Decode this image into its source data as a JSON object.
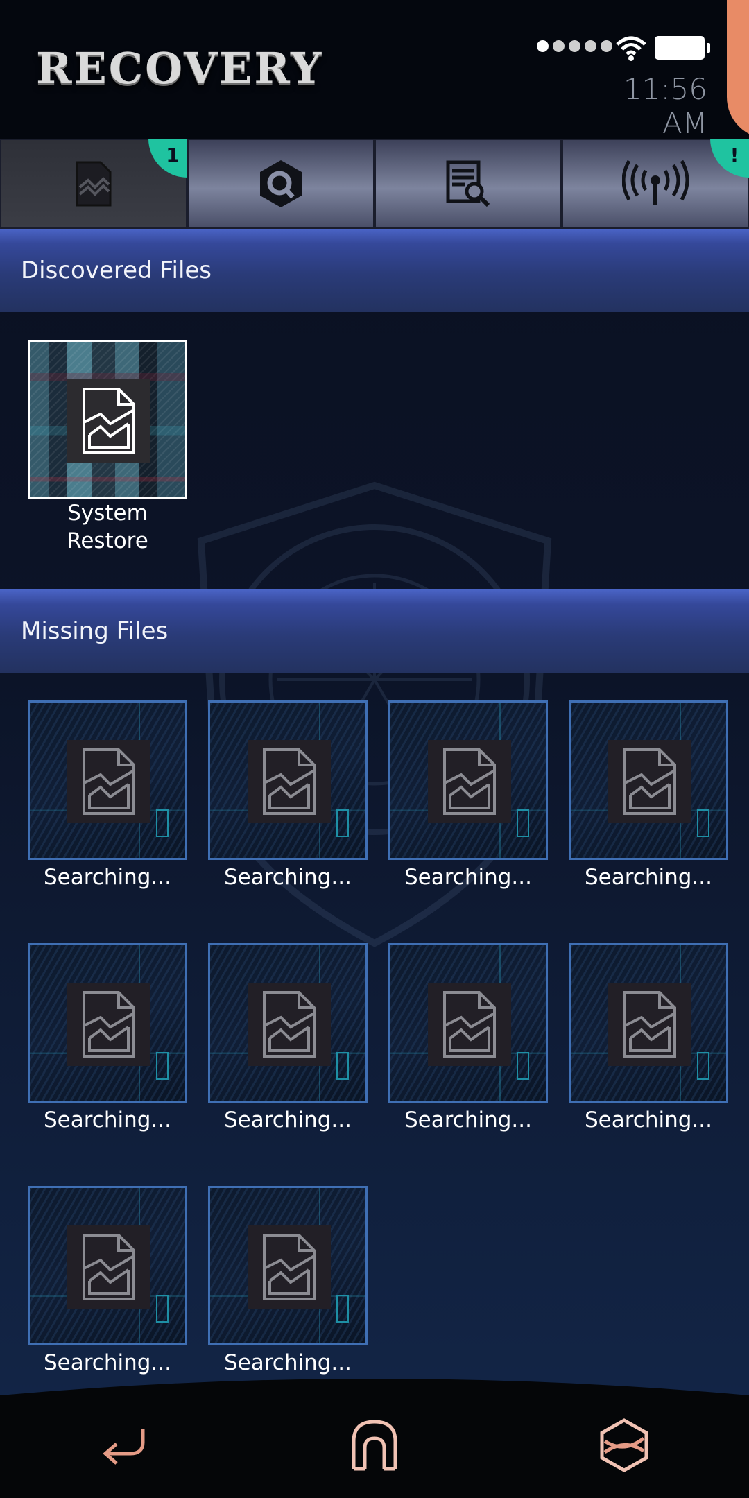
{
  "app": {
    "title": "RECOVERY",
    "clock": "11:56 AM"
  },
  "tabs": [
    {
      "name": "recovered-files",
      "icon": "corrupted-file-icon",
      "badge": "1",
      "active": true
    },
    {
      "name": "scan",
      "icon": "hexagon-search-icon",
      "badge": null,
      "active": false
    },
    {
      "name": "document-search",
      "icon": "document-magnifier-icon",
      "badge": null,
      "active": false
    },
    {
      "name": "broadcast",
      "icon": "broadcast-antenna-icon",
      "badge": "!",
      "active": false
    }
  ],
  "discovered": {
    "header": "Discovered Files",
    "files": [
      {
        "label_line1": "System",
        "label_line2": "Restore"
      }
    ]
  },
  "missing": {
    "header": "Missing Files",
    "files": [
      {
        "label": "Searching..."
      },
      {
        "label": "Searching..."
      },
      {
        "label": "Searching..."
      },
      {
        "label": "Searching..."
      },
      {
        "label": "Searching..."
      },
      {
        "label": "Searching..."
      },
      {
        "label": "Searching..."
      },
      {
        "label": "Searching..."
      },
      {
        "label": "Searching..."
      },
      {
        "label": "Searching..."
      }
    ]
  },
  "nav": {
    "back_icon": "back-arrow-icon",
    "home_icon": "home-icon",
    "apps_icon": "hexagon-apps-icon"
  },
  "colors": {
    "accent_badge": "#1fc3a0",
    "tile_border": "#3f6fb4",
    "nav_icon": "#e59b86"
  }
}
